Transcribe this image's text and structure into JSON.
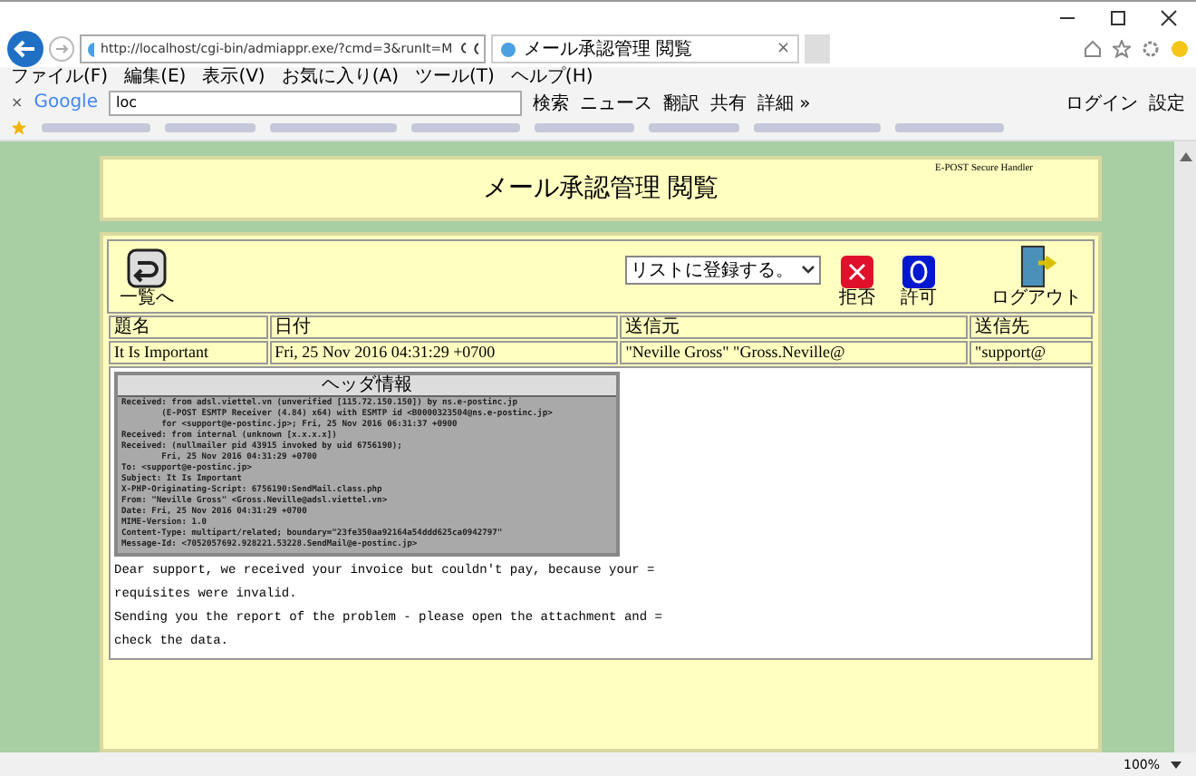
{
  "browser": {
    "url": "http://localhost/cgi-bin/admiappr.exe/?cmd=3&runIt=M",
    "tab": {
      "title": "メール承認管理 閲覧",
      "close": "×"
    },
    "menu": [
      "ファイル(F)",
      "編集(E)",
      "表示(V)",
      "お気に入り(A)",
      "ツール(T)",
      "ヘルプ(H)"
    ],
    "google": {
      "close": "×",
      "logo": "Google",
      "query": "loc",
      "buttons": [
        "検索",
        "ニュース",
        "翻訳",
        "共有",
        "詳細 »"
      ],
      "login": "ログイン",
      "settings": "設定"
    }
  },
  "page": {
    "title": "メール承認管理 閲覧",
    "brand": "E-POST Secure Handler",
    "toolbar": {
      "back": "一覧へ",
      "list_select": "リストに登録する。",
      "reject": "拒否",
      "allow": "許可",
      "logout": "ログアウト"
    },
    "table": {
      "columns": [
        "題名",
        "日付",
        "送信元",
        "送信先"
      ],
      "row": [
        "It Is Important",
        "Fri, 25 Nov 2016 04:31:29 +0700",
        "\"Neville Gross\" \"Gross.Neville@",
        "\"support@"
      ]
    },
    "header_title": "ヘッダ情報",
    "header_lines": [
      "Received: from adsl.viettel.vn (unverified [115.72.150.150]) by ns.e-postinc.jp",
      "        (E-POST ESMTP Receiver (4.84) x64) with ESMTP id <B0000323504@ns.e-postinc.jp>",
      "        for <support@e-postinc.jp>; Fri, 25 Nov 2016 06:31:37 +0900",
      "Received: from internal (unknown [x.x.x.x])",
      "Received: (nullmailer pid 43915 invoked by uid 6756190);",
      "        Fri, 25 Nov 2016 04:31:29 +0700",
      "To: <support@e-postinc.jp>",
      "Subject: It Is Important",
      "X-PHP-Originating-Script: 6756190:SendMail.class.php",
      "From: \"Neville Gross\" <Gross.Neville@adsl.viettel.vn>",
      "Date: Fri, 25 Nov 2016 04:31:29 +0700",
      "MIME-Version: 1.0",
      "Content-Type: multipart/related; boundary=\"23fe350aa92164a54ddd625ca0942797\"",
      "Message-Id: <7052057692.928221.53228.SendMail@e-postinc.jp>"
    ],
    "body_lines": [
      "Dear support, we received your invoice but couldn't pay, because your =",
      "requisites were invalid.",
      "Sending you the report of the problem - please open the attachment and =",
      "check the data."
    ]
  },
  "status_bar": {
    "zoom": "100%"
  }
}
